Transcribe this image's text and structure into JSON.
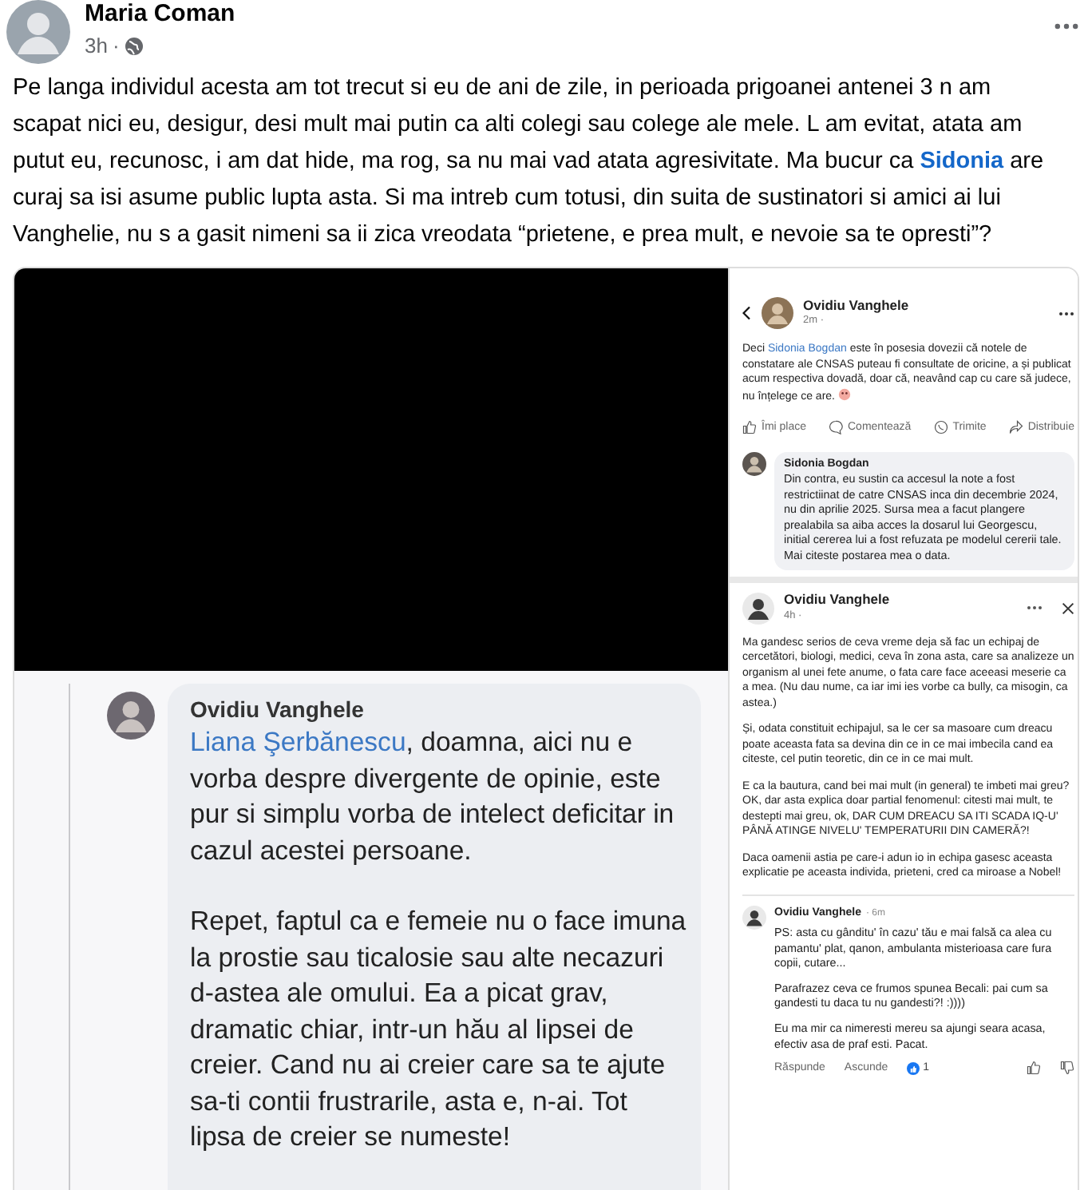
{
  "post": {
    "author": "Maria Coman",
    "time": "3h",
    "separator": "·",
    "body": [
      {
        "kind": "text",
        "text": "Pe langa individul acesta am tot trecut si eu de ani de zile, in perioada prigoanei antenei 3 n am scapat nici eu, desigur, desi mult mai putin ca alti colegi sau colege ale mele. L am evitat, atata am putut eu, recunosc, i am dat hide, ma rog, sa nu mai vad atata agresivitate. Ma bucur ca "
      },
      {
        "kind": "mention",
        "text": "Sidonia"
      },
      {
        "kind": "text",
        "text": " are curaj sa isi asume public lupta asta. Si ma intreb cum totusi, din suita de sustinatori si amici ai lui Vanghelie, nu s a gasit nimeni sa ii zica vreodata “prietene, e prea mult, e nevoie sa te opresti”?"
      }
    ]
  },
  "left_screenshot": {
    "author": "Ovidiu Vanghele",
    "paragraphs": [
      [
        {
          "kind": "mention",
          "text": "Liana Şerbănescu"
        },
        {
          "kind": "text",
          "text": ", doamna, aici nu e vorba despre divergente de opinie, este pur si simplu vorba de intelect deficitar in cazul acestei persoane."
        }
      ],
      [
        {
          "kind": "text",
          "text": "Repet, faptul ca e femeie nu o face imuna la prostie sau ticalosie sau alte necazuri d-astea ale omului. Ea a picat grav, dramatic chiar, intr-un hău al lipsei de creier. Cand nu ai creier care sa te ajute sa-ti contii frustrarile, asta e, n-ai. Tot lipsa de creier se numeste!"
        }
      ]
    ]
  },
  "right_top": {
    "author": "Ovidiu Vanghele",
    "time": "2m ·",
    "body": [
      {
        "kind": "text",
        "text": "Deci "
      },
      {
        "kind": "mention",
        "text": "Sidonia Bogdan"
      },
      {
        "kind": "text",
        "text": " este în posesia dovezii că notele de constatare ale CNSAS puteau fi consultate de oricine, a și publicat acum respectiva dovadă, doar că, neavând cap cu care să judece, nu înțelege ce are."
      }
    ],
    "actions": [
      {
        "kind": "like",
        "label": "Îmi place"
      },
      {
        "kind": "comment",
        "label": "Comentează"
      },
      {
        "kind": "send",
        "label": "Trimite"
      },
      {
        "kind": "share",
        "label": "Distribuie"
      }
    ],
    "comment": {
      "author": "Sidonia Bogdan",
      "text": "Din contra, eu sustin ca accesul la note a fost restrictiinat de catre CNSAS inca din decembrie 2024, nu din aprilie 2025. Sursa mea a facut plangere prealabila sa aiba acces la dosarul lui Georgescu, initial cererea lui a fost refuzata pe modelul cererii tale. Mai citeste postarea mea o data."
    }
  },
  "right_bottom": {
    "author": "Ovidiu Vanghele",
    "time": "4h ·",
    "paragraphs": [
      "Ma gandesc serios de ceva vreme deja să fac un echipaj de cercetători, biologi, medici, ceva în zona asta, care sa analizeze un organism al unei fete anume, o fata care face aceeasi meserie ca a mea. (Nu dau nume, ca iar imi ies vorbe ca bully, ca misogin, ca astea.)",
      "Și, odata constituit echipajul, sa le cer sa masoare cum dreacu poate aceasta fata sa devina din ce in ce mai imbecila cand ea citeste, cel putin teoretic, din ce in ce mai mult.",
      "E ca la bautura, cand bei mai mult (in general) te imbeti mai greu? OK, dar asta explica doar partial fenomenul: citesti mai mult, te destepti mai greu, ok, DAR CUM DREACU SA ITI SCADA IQ-U' PÂNĂ ATINGE NIVELU' TEMPERATURII DIN CAMERĂ?!",
      "Daca oamenii astia pe care-i adun io in echipa gasesc aceasta explicatie pe aceasta individa, prieteni, cred ca miroase a Nobel!"
    ],
    "comment": {
      "author": "Ovidiu Vanghele",
      "time": "· 6m",
      "paragraphs": [
        "PS: asta cu gânditu' în cazu' tău e mai falsă ca alea cu pamantu' plat, qanon, ambulanta misterioasa care fura copii, cutare...",
        "Parafrazez ceva ce frumos spunea Becali: pai cum sa gandesti tu daca tu nu gandesti?! :))))",
        "Eu ma mir ca nimeresti mereu sa ajungi seara acasa, efectiv asa de praf esti. Pacat."
      ],
      "links": [
        "Răspunde",
        "Ascunde"
      ],
      "reaction_count": "1"
    }
  }
}
